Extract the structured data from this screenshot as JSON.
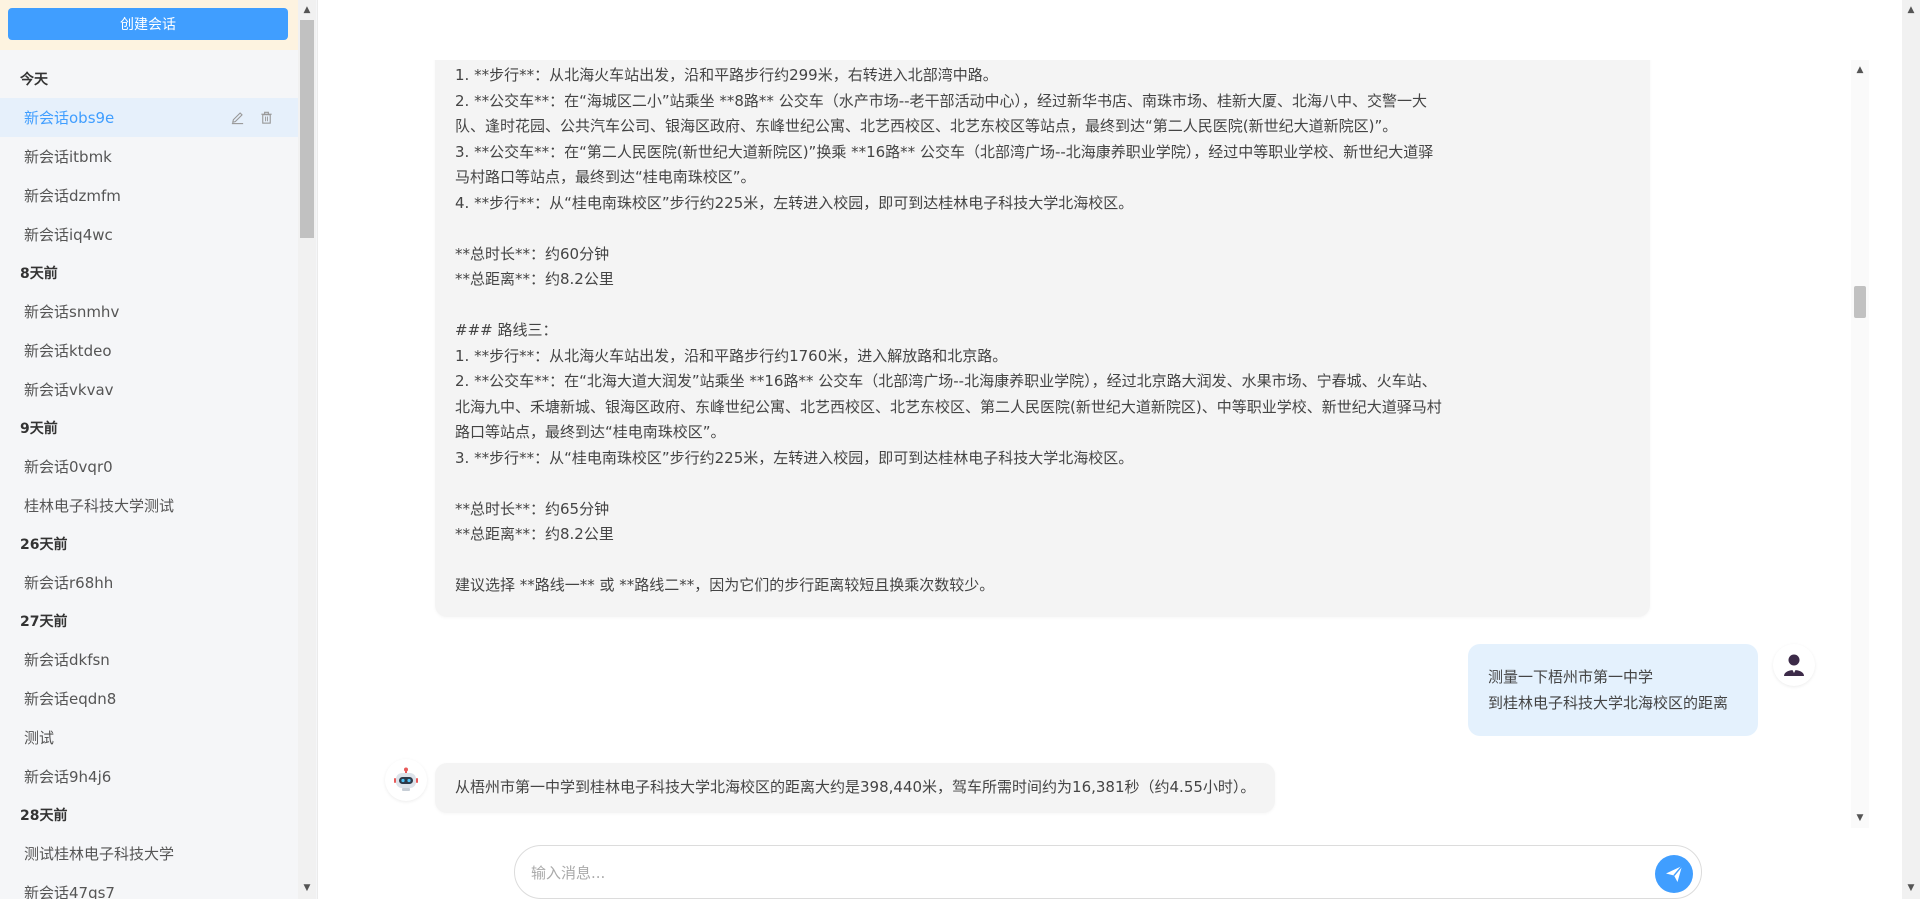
{
  "sidebar": {
    "create_label": "创建会话",
    "groups": [
      {
        "title": "今天",
        "items": [
          "新会话obs9e",
          "新会话itbmk",
          "新会话dzmfm",
          "新会话iq4wc"
        ]
      },
      {
        "title": "8天前",
        "items": [
          "新会话snmhv",
          "新会话ktdeo",
          "新会话vkvav"
        ]
      },
      {
        "title": "9天前",
        "items": [
          "新会话0vqr0",
          "桂林电子科技大学测试"
        ]
      },
      {
        "title": "26天前",
        "items": [
          "新会话r68hh"
        ]
      },
      {
        "title": "27天前",
        "items": [
          "新会话dkfsn",
          "新会话eqdn8",
          "测试",
          "新会话9h4j6"
        ]
      },
      {
        "title": "28天前",
        "items": [
          "测试桂林电子科技大学",
          "新会话47qs7"
        ]
      }
    ]
  },
  "chat": {
    "bot_message_1": [
      "1. **步行**：从北海火车站出发，沿和平路步行约299米，右转进入北部湾中路。",
      "2. **公交车**：在“海城区二小”站乘坐 **8路** 公交车（水产市场--老干部活动中心），经过新华书店、南珠市场、桂新大厦、北海八中、交警一大",
      "队、逢时花园、公共汽车公司、银海区政府、东峰世纪公寓、北艺西校区、北艺东校区等站点，最终到达“第二人民医院(新世纪大道新院区)”。",
      "3. **公交车**：在“第二人民医院(新世纪大道新院区)”换乘 **16路** 公交车（北部湾广场--北海康养职业学院），经过中等职业学校、新世纪大道驿",
      "马村路口等站点，最终到达“桂电南珠校区”。",
      "4. **步行**：从“桂电南珠校区”步行约225米，左转进入校园，即可到达桂林电子科技大学北海校区。",
      "",
      "**总时长**：约60分钟",
      "**总距离**：约8.2公里",
      "",
      "### 路线三：",
      "1. **步行**：从北海火车站出发，沿和平路步行约1760米，进入解放路和北京路。",
      "2. **公交车**：在“北海大道大润发”站乘坐 **16路** 公交车（北部湾广场--北海康养职业学院），经过北京路大润发、水果市场、宁春城、火车站、",
      "北海九中、禾塘新城、银海区政府、东峰世纪公寓、北艺西校区、北艺东校区、第二人民医院(新世纪大道新院区)、中等职业学校、新世纪大道驿马村",
      "路口等站点，最终到达“桂电南珠校区”。",
      "3. **步行**：从“桂电南珠校区”步行约225米，左转进入校园，即可到达桂林电子科技大学北海校区。",
      "",
      "**总时长**：约65分钟",
      "**总距离**：约8.2公里",
      "",
      "建议选择 **路线一** 或 **路线二**，因为它们的步行距离较短且换乘次数较少。"
    ],
    "user_message": [
      "测量一下梧州市第一中学",
      "到桂林电子科技大学北海校区的距离"
    ],
    "bot_message_2": "从梧州市第一中学到桂林电子科技大学北海校区的距离大约是398,440米，驾车所需时间约为16,381秒（约4.55小时）。"
  },
  "input": {
    "placeholder": "输入消息..."
  },
  "colors": {
    "accent": "#409eff",
    "active_bg": "#e6f0fb",
    "user_bubble": "#e4f1fd",
    "bot_bubble": "#f4f4f4"
  }
}
